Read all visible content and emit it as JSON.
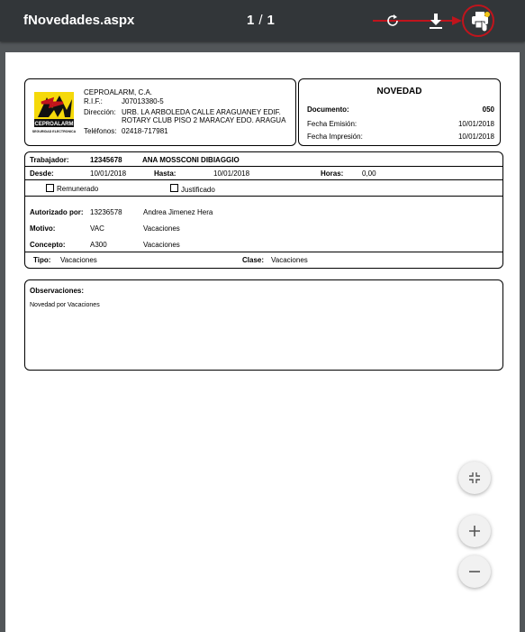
{
  "toolbar": {
    "title": "fNovedades.aspx",
    "current_page": "1",
    "separator": "/",
    "total_pages": "1",
    "icons": [
      "rotate-icon",
      "download-icon",
      "print-icon"
    ]
  },
  "company": {
    "name": "CEPROALARM, C.A.",
    "rif_label": "R.I.F.:",
    "rif": "J07013380-5",
    "address_label": "Dirección:",
    "address_line1": "URB. LA ARBOLEDA CALLE ARAGUANEY EDIF.",
    "address_line2": "ROTARY CLUB PISO 2 MARACAY EDO. ARAGUA",
    "phone_label": "Teléfonos:",
    "phone": "02418-717981",
    "logo_text": "CEPROALARM",
    "logo_subtext": "SEGURIDAD ELECTRONICA"
  },
  "novedad": {
    "heading": "NOVEDAD",
    "documento_label": "Documento:",
    "documento": "050",
    "fecha_emision_label": "Fecha Emisión:",
    "fecha_emision": "10/01/2018",
    "fecha_impresion_label": "Fecha Impresión:",
    "fecha_impresion": "10/01/2018"
  },
  "detail": {
    "trabajador_label": "Trabajador:",
    "trabajador_id": "12345678",
    "trabajador_name": "ANA MOSSCONI DIBIAGGIO",
    "desde_label": "Desde:",
    "desde": "10/01/2018",
    "hasta_label": "Hasta:",
    "hasta": "10/01/2018",
    "horas_label": "Horas:",
    "horas": "0,00",
    "remunerado_label": "Remunerado",
    "justificado_label": "Justificado",
    "autorizado_label": "Autorizado por:",
    "autorizado_id": "13236578",
    "autorizado_name": "Andrea Jimenez Hera",
    "motivo_label": "Motivo:",
    "motivo_code": "VAC",
    "motivo_desc": "Vacaciones",
    "concepto_label": "Concepto:",
    "concepto_code": "A300",
    "concepto_desc": "Vacaciones",
    "tipo_label": "Tipo:",
    "tipo": "Vacaciones",
    "clase_label": "Clase:",
    "clase": "Vacaciones"
  },
  "observaciones": {
    "label": "Observaciones:",
    "text": "Novedad por Vacaciones"
  },
  "zoom": {
    "icons": [
      "fit-page-icon",
      "zoom-in-icon",
      "zoom-out-icon"
    ]
  }
}
